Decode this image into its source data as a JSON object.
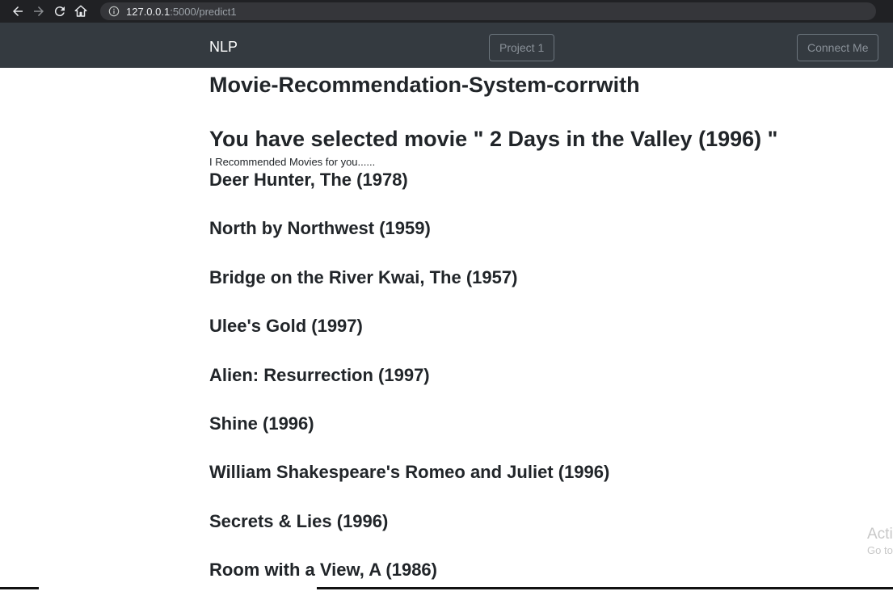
{
  "browser": {
    "url_host": "127.0.0.1",
    "url_path": ":5000/predict1",
    "icons": [
      "back-arrow-icon",
      "forward-arrow-icon",
      "reload-icon",
      "home-icon",
      "info-icon"
    ]
  },
  "navbar": {
    "brand": "NLP",
    "project_label": "Project 1",
    "connect_label": "Connect Me"
  },
  "main": {
    "title": "Movie-Recommendation-System-corrwith",
    "selected_text": "You have selected movie \" 2 Days in the Valley (1996) \"",
    "intro": "I Recommended Movies for you......",
    "movies": [
      "Deer Hunter, The (1978)",
      "North by Northwest (1959)",
      "Bridge on the River Kwai, The (1957)",
      "Ulee's Gold (1997)",
      "Alien: Resurrection (1997)",
      "Shine (1996)",
      "William Shakespeare's Romeo and Juliet (1996)",
      "Secrets & Lies (1996)",
      "Room with a View, A (1986)"
    ]
  },
  "watermark": {
    "line1": "Acti",
    "line2": "Go to"
  },
  "colors": {
    "navbar_bg": "#343a40",
    "browser_bg": "#202124",
    "text": "#212529"
  }
}
